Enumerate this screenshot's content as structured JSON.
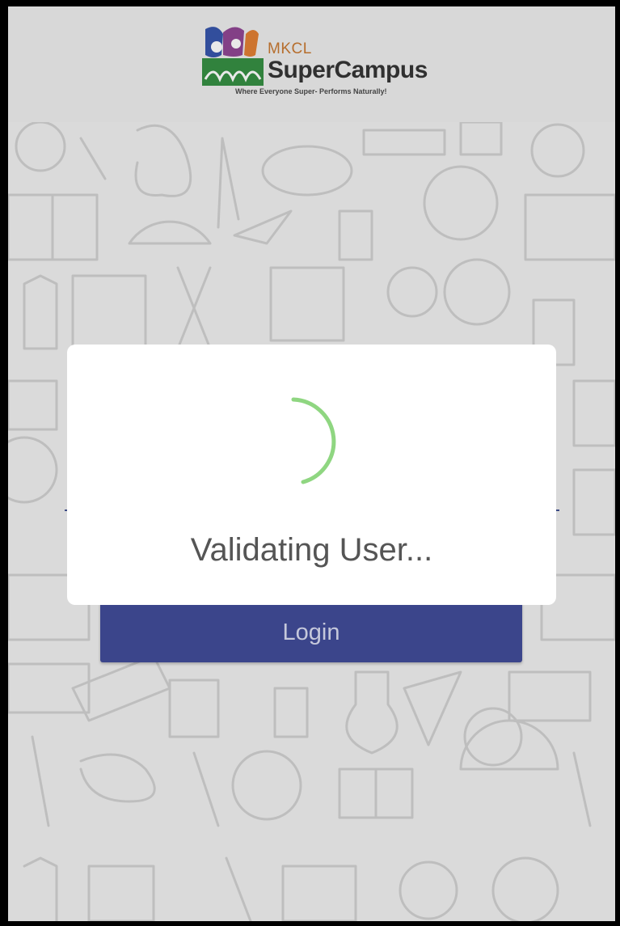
{
  "app": {
    "brand_top": "MKCL",
    "brand_name": "SuperCampus",
    "tagline": "Where Everyone Super- Performs Naturally!"
  },
  "form": {
    "login_label": "Login"
  },
  "dialog": {
    "message": "Validating User..."
  },
  "colors": {
    "login_button": "#3a4594",
    "spinner": "#8fd681",
    "brand_orange": "#c5732a"
  }
}
